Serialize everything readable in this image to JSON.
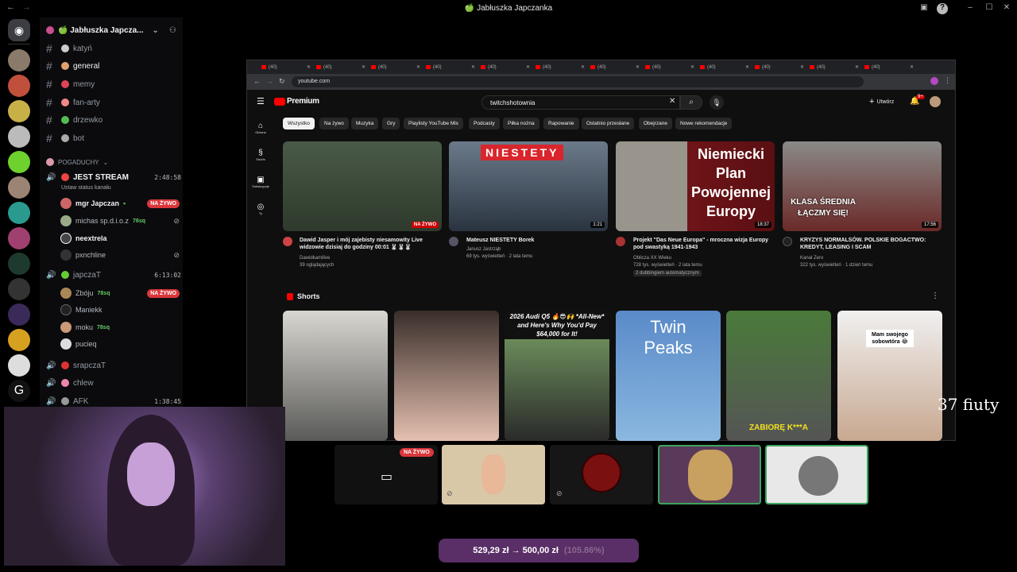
{
  "window": {
    "title": "🍏 Jabłuszka Japczanka"
  },
  "discord": {
    "server_name": "🍏 Jabłuszka Japcza...",
    "channels": [
      {
        "name": "katyń"
      },
      {
        "name": "general"
      },
      {
        "name": "memy"
      },
      {
        "name": "fan-arty"
      },
      {
        "name": "drzewko"
      },
      {
        "name": "bot"
      }
    ],
    "category": "POGADUCHY",
    "voice1": {
      "name": "JEST STREAM",
      "time": "2:48:58",
      "status": "Ustaw status kanału",
      "users": [
        {
          "name": "mgr Japczan",
          "badge": "NA ŻYWO"
        },
        {
          "name": "michas sp.d.i.o.z",
          "count": "78sq"
        },
        {
          "name": "neextrela"
        },
        {
          "name": "pxnchline"
        }
      ]
    },
    "voice2": {
      "name": "japczaT",
      "time": "6:13:02",
      "users": [
        {
          "name": "Zbóju",
          "count": "78sq",
          "badge": "NA ŻYWO"
        },
        {
          "name": "Maniekk"
        },
        {
          "name": "moku",
          "count": "78sq"
        },
        {
          "name": "pucieq"
        }
      ]
    },
    "voice3": {
      "name": "srapczaT"
    },
    "voice4": {
      "name": "chlew"
    },
    "voice5": {
      "name": "AFK",
      "time": "1:38:45"
    }
  },
  "browser": {
    "tab_label": "(40)",
    "url": "youtube.com"
  },
  "youtube": {
    "logo": "Premium",
    "search_value": "twitchshotownia",
    "create_label": "Utwórz",
    "notif_count": "9+",
    "sidebar": [
      "Główna",
      "Shorts",
      "Subskrypcje",
      "Ty"
    ],
    "chips": [
      "Wszystko",
      "Na żywo",
      "Muzyka",
      "Gry",
      "Playlisty YouTube Mix",
      "Podcasty",
      "Piłka nożna",
      "Rapowanie",
      "Ostatnio przesłane",
      "Obejrzane",
      "Nowe rekomendacje"
    ],
    "videos": [
      {
        "title": "Dawid Jasper i mój zajebisty niesamowity Live widzowie dzisiaj do godziny 00:01 🐰🐰🐰",
        "channel": "Dawidkamilive",
        "meta": "39 oglądających",
        "badge": "NA ŻYWO",
        "thumb_text": ""
      },
      {
        "title": "Mateusz NIESTETY Borek",
        "channel": "Janusz Jastrząb",
        "meta": "69 tys. wyświetleń · 2 lata temu",
        "badge": "1:21",
        "thumb_text": "NIESTETY"
      },
      {
        "title": "Projekt \"Das Neue Europa\" - mroczna wizja Europy pod swastyką 1941-1943",
        "channel": "Oblicza XX Wieku",
        "meta": "728 tys. wyświetleń · 2 lata temu",
        "extra": "2 dubbingiem automatycznym",
        "badge": "18:37",
        "thumb_text": "Niemiecki Plan Powojennej Europy"
      },
      {
        "title": "KRYZYS NORMALSÓW. POLSKIE BOGACTWO: KREDYT, LEASING I SCAM",
        "channel": "Kanał Zero",
        "meta": "322 tys. wyświetleń · 1 dzień temu",
        "badge": "17:56",
        "thumb_text": "KLASA ŚREDNIA ŁĄCZMY SIĘ!"
      }
    ],
    "shorts_heading": "Shorts",
    "shorts": [
      {
        "text": ""
      },
      {
        "text": ""
      },
      {
        "text": "2026 Audi Q5 🔥😎🙌 *All-New* and Here's Why You'd Pay $64,000 for It!"
      },
      {
        "text": "Twin Peaks"
      },
      {
        "text": "ZABIORĘ K***A"
      },
      {
        "text": "Mam swojego sobowtóra 😂"
      }
    ]
  },
  "call": {
    "live_badge": "NA ŻYWO"
  },
  "price": {
    "text": "529,29 zł → 500,00 zł",
    "pct": "(105.86%)"
  },
  "overlay": {
    "text": "37 fiuty"
  }
}
